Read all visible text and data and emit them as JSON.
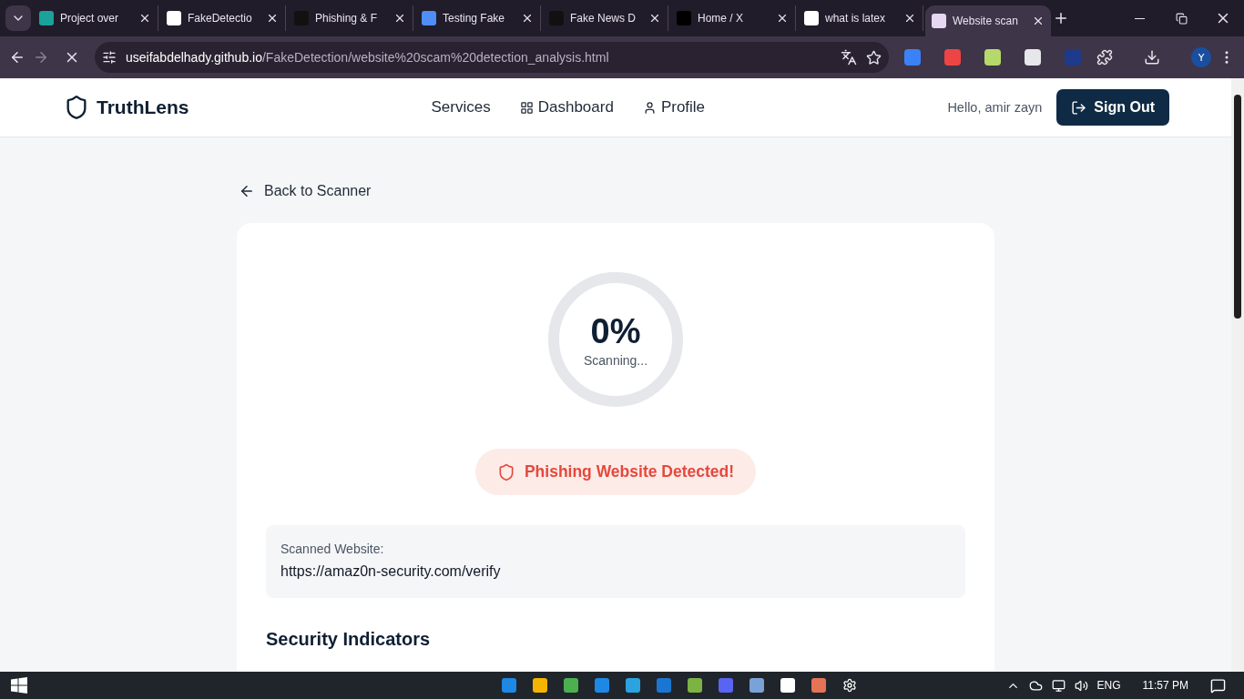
{
  "browser": {
    "tabs": [
      {
        "title": "Project over",
        "selected": false
      },
      {
        "title": "FakeDetectio",
        "selected": false
      },
      {
        "title": "Phishing & F",
        "selected": false
      },
      {
        "title": "Testing Fake",
        "selected": false
      },
      {
        "title": "Fake News D",
        "selected": false
      },
      {
        "title": "Home / X",
        "selected": false
      },
      {
        "title": "what is latex",
        "selected": false
      },
      {
        "title": "Website scan",
        "selected": true
      }
    ],
    "url_host": "useifabdelhady.github.io",
    "url_path": "/FakeDetection/website%20scam%20detection_analysis.html",
    "profile_initial": "Y"
  },
  "header": {
    "brand": "TruthLens",
    "nav": [
      "Services",
      "Dashboard",
      "Profile"
    ],
    "greeting": "Hello, amir zayn",
    "sign_out": "Sign Out"
  },
  "back_link": "Back to Scanner",
  "scan": {
    "percent": "0%",
    "level": 0,
    "status": "Scanning...",
    "alert": "Phishing Website Detected!",
    "scanned_label": "Scanned Website:",
    "scanned_url": "https://amaz0n-security.com/verify"
  },
  "section_title": "Security Indicators",
  "taskbar": {
    "language": "ENG",
    "time": "11:57 PM"
  }
}
